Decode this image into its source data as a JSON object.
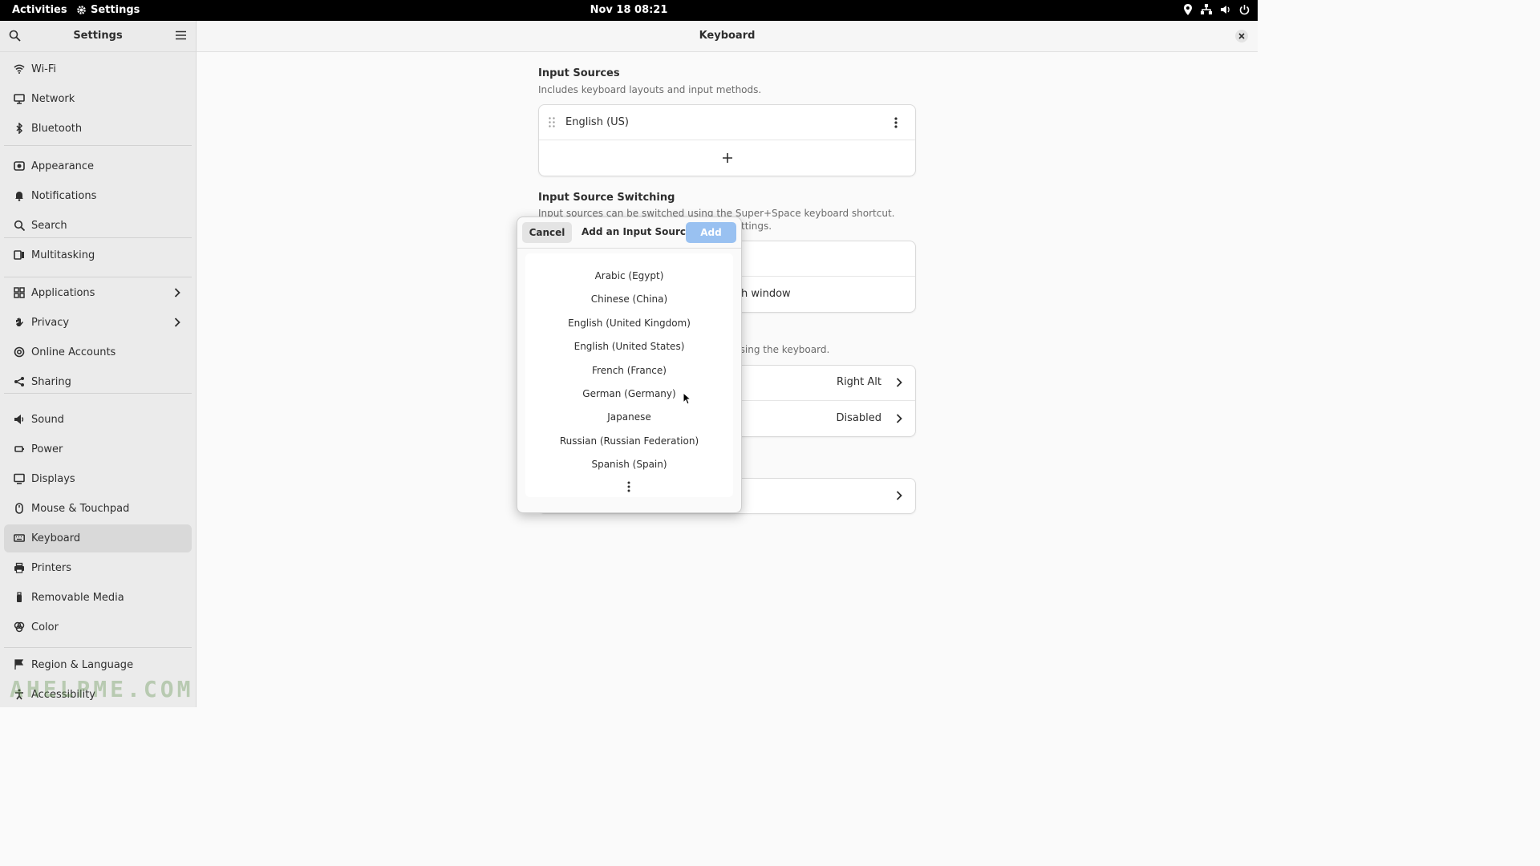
{
  "topbar": {
    "activities": "Activities",
    "app_name": "Settings",
    "clock": "Nov 18  08:21"
  },
  "sidebar": {
    "title": "Settings",
    "items": [
      {
        "label": "Wi-Fi",
        "icon": "wifi-icon"
      },
      {
        "label": "Network",
        "icon": "network-icon"
      },
      {
        "label": "Bluetooth",
        "icon": "bluetooth-icon"
      },
      {
        "label": "Appearance",
        "icon": "appearance-icon"
      },
      {
        "label": "Notifications",
        "icon": "bell-icon"
      },
      {
        "label": "Search",
        "icon": "search-icon"
      },
      {
        "label": "Multitasking",
        "icon": "multitasking-icon"
      },
      {
        "label": "Applications",
        "icon": "grid-icon"
      },
      {
        "label": "Privacy",
        "icon": "hand-icon"
      },
      {
        "label": "Online Accounts",
        "icon": "at-icon"
      },
      {
        "label": "Sharing",
        "icon": "share-icon"
      },
      {
        "label": "Sound",
        "icon": "speaker-icon"
      },
      {
        "label": "Power",
        "icon": "power-icon"
      },
      {
        "label": "Displays",
        "icon": "display-icon"
      },
      {
        "label": "Mouse & Touchpad",
        "icon": "mouse-icon"
      },
      {
        "label": "Keyboard",
        "icon": "keyboard-icon"
      },
      {
        "label": "Printers",
        "icon": "printer-icon"
      },
      {
        "label": "Removable Media",
        "icon": "usb-icon"
      },
      {
        "label": "Color",
        "icon": "color-icon"
      },
      {
        "label": "Region & Language",
        "icon": "flag-icon"
      },
      {
        "label": "Accessibility",
        "icon": "accessibility-icon"
      }
    ],
    "active": "Keyboard"
  },
  "main": {
    "title": "Keyboard",
    "input_sources": {
      "title": "Input Sources",
      "subtitle": "Includes keyboard layouts and input methods.",
      "source": "English (US)"
    },
    "switching": {
      "title": "Input Source Switching",
      "subtitle_line1": "Input sources can be switched using the Super+Space keyboard shortcut.",
      "subtitle_line2": "ttings.",
      "row2_partial": "h window"
    },
    "special": {
      "subtitle_partial": "s using the keyboard.",
      "row1_value": "Right Alt",
      "row2_value": "Disabled"
    }
  },
  "dialog": {
    "cancel": "Cancel",
    "title": "Add an Input Source",
    "add": "Add",
    "languages": [
      "Arabic (Egypt)",
      "Chinese (China)",
      "English (United Kingdom)",
      "English (United States)",
      "French (France)",
      "German (Germany)",
      "Japanese",
      "Russian (Russian Federation)",
      "Spanish (Spain)"
    ]
  },
  "watermark": "AHELPME.COM",
  "colors": {
    "add_button": "#99c1f1",
    "active_item": "#d9d9d9"
  }
}
